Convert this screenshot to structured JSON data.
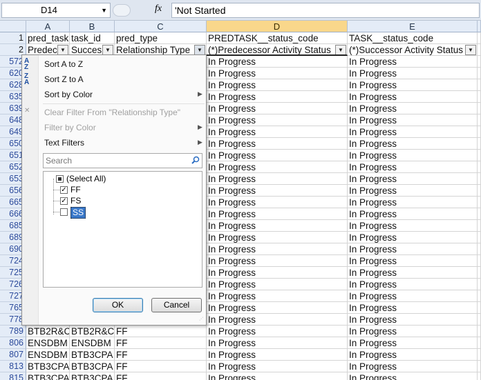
{
  "formula_bar": {
    "name_box": "D14",
    "fx_label": "fx",
    "content": "'Not Started"
  },
  "columns": [
    {
      "letter": "A"
    },
    {
      "letter": "B"
    },
    {
      "letter": "C"
    },
    {
      "letter": "D",
      "selected": true
    },
    {
      "letter": "E"
    }
  ],
  "header_row1": {
    "row_num": "1",
    "cells": [
      "pred_task",
      "task_id",
      "pred_type",
      "PREDTASK__status_code",
      "TASK__status_code"
    ]
  },
  "header_row2": {
    "row_num": "2",
    "cells": [
      "Predec",
      "Succes",
      "Relationship Type",
      "(*)Predecessor Activity Status",
      "(*)Successor Activity Status"
    ]
  },
  "row_numbers": [
    "572",
    "620",
    "628",
    "635",
    "639",
    "648",
    "649",
    "650",
    "651",
    "652",
    "653",
    "656",
    "665",
    "666",
    "685",
    "689",
    "690",
    "724",
    "725",
    "726",
    "727",
    "765",
    "778",
    "789",
    "806",
    "807",
    "813",
    "815"
  ],
  "visible_rows": [
    {
      "a": "BTB2R&C",
      "b": "BTB2R&C",
      "c": "FF"
    },
    {
      "a": "ENSDBM",
      "b": "ENSDBM",
      "c": "FF"
    },
    {
      "a": "ENSDBM",
      "b": "BTB3CPA",
      "c": "FF"
    },
    {
      "a": "BTB3CPA",
      "b": "BTB3CPA",
      "c": "FF"
    },
    {
      "a": "BTB3CPA",
      "b": "BTB3CPA",
      "c": "FF"
    }
  ],
  "status_value": "In Progress",
  "filter_menu": {
    "sort_asc": "Sort A to Z",
    "sort_desc": "Sort Z to A",
    "sort_color": "Sort by Color",
    "clear_filter": "Clear Filter From \"Relationship Type\"",
    "filter_color": "Filter by Color",
    "text_filters": "Text Filters",
    "search_placeholder": "Search",
    "items": [
      {
        "label": "(Select All)",
        "state": "indeterminate"
      },
      {
        "label": "FF",
        "state": "checked"
      },
      {
        "label": "FS",
        "state": "checked"
      },
      {
        "label": "SS",
        "state": "unchecked"
      }
    ],
    "ok_label": "OK",
    "cancel_label": "Cancel"
  },
  "colors": {
    "selected_column": "#f9d78b",
    "header_bg": "#e4ecf7",
    "row_number_text": "#2b4a9b"
  }
}
